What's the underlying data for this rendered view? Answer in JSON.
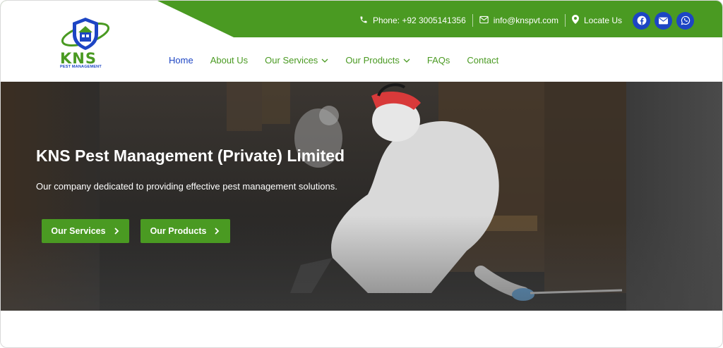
{
  "brand": {
    "logo_name": "KNS",
    "logo_tagline": "PEST MANAGEMENT",
    "green": "#4a9a22",
    "blue": "#1d45c4"
  },
  "topbar": {
    "phone": "Phone: +92 3005141356",
    "email": "info@knspvt.com",
    "locate": "Locate Us",
    "icons": [
      "phone-icon",
      "envelope-icon",
      "map-marker-icon"
    ],
    "social": [
      "facebook-icon",
      "email-icon",
      "whatsapp-icon"
    ]
  },
  "nav": {
    "items": [
      {
        "label": "Home",
        "active": true,
        "dropdown": false
      },
      {
        "label": "About Us",
        "active": false,
        "dropdown": false
      },
      {
        "label": "Our Services",
        "active": false,
        "dropdown": true
      },
      {
        "label": "Our Products",
        "active": false,
        "dropdown": true
      },
      {
        "label": "FAQs",
        "active": false,
        "dropdown": false
      },
      {
        "label": "Contact",
        "active": false,
        "dropdown": false
      }
    ]
  },
  "hero": {
    "title": "KNS Pest Management (Private) Limited",
    "subtitle": "Our company dedicated to providing effective pest management solutions.",
    "buttons": [
      {
        "label": "Our Services"
      },
      {
        "label": "Our Products"
      }
    ]
  }
}
